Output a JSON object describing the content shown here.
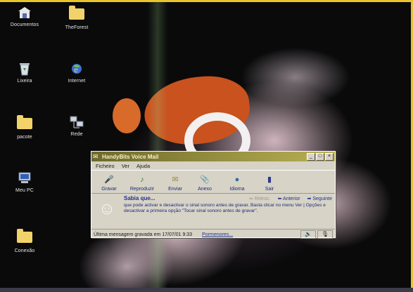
{
  "desktop": {
    "icons": [
      {
        "label": "Documentos",
        "icon": "documents-icon"
      },
      {
        "label": "TheForest",
        "icon": "folder-icon"
      },
      {
        "label": "Lixeira",
        "icon": "recycle-bin-icon"
      },
      {
        "label": "Internet",
        "icon": "internet-icon"
      },
      {
        "label": "pacote",
        "icon": "folder-icon"
      },
      {
        "label": "Rede",
        "icon": "network-icon"
      },
      {
        "label": "Meu PC",
        "icon": "computer-icon"
      },
      {
        "label": "Conexão",
        "icon": "folder-icon"
      }
    ]
  },
  "window": {
    "title": "HandyBits Voice Mail",
    "controls": {
      "minimize": "_",
      "maximize": "□",
      "close": "×"
    },
    "menu": [
      "Ficheiro",
      "Ver",
      "Ajuda"
    ],
    "toolbar": [
      {
        "label": "Gravar",
        "icon": "record-icon"
      },
      {
        "label": "Reproduzir",
        "icon": "play-icon"
      },
      {
        "label": "Enviar",
        "icon": "send-icon"
      },
      {
        "label": "Anexo",
        "icon": "attach-icon"
      },
      {
        "label": "Idioma",
        "icon": "language-icon"
      },
      {
        "label": "Sair",
        "icon": "exit-icon"
      }
    ],
    "tip": {
      "heading": "Sabia que...",
      "back_label": "Retroc.",
      "prev_label": "Anterior",
      "next_label": "Seguinte",
      "text": "que pode activar e desactivar o sinal sonoro antes de gravar. Basta clicar no menu Ver | Opções e desactivar a primeira opção \"Tocar sinal sonoro antes de gravar\"."
    },
    "status": {
      "text": "Última mensagem gravada em 17/07/01 9:33",
      "link": "Pormenores..."
    }
  }
}
